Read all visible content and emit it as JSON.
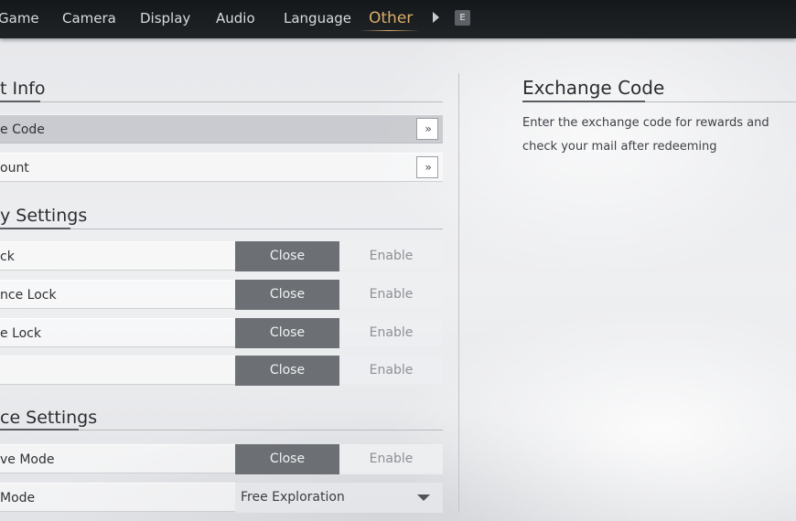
{
  "nav": {
    "tabs": [
      "Game",
      "Camera",
      "Display",
      "Audio",
      "Language",
      "Other"
    ],
    "active_tab": "Other",
    "next_key_hint": "E"
  },
  "account_section": {
    "title": "t Info",
    "rows": [
      {
        "label": "e Code",
        "action": "»"
      },
      {
        "label": "ount",
        "action": "»"
      }
    ]
  },
  "privacy_section": {
    "title": "y Settings",
    "rows": [
      {
        "label": "ck",
        "off_label": "Close",
        "on_label": "Enable",
        "selected": "Close"
      },
      {
        "label": "nce Lock",
        "off_label": "Close",
        "on_label": "Enable",
        "selected": "Close"
      },
      {
        "label": "e Lock",
        "off_label": "Close",
        "on_label": "Enable",
        "selected": "Close"
      },
      {
        "label": "",
        "off_label": "Close",
        "on_label": "Enable",
        "selected": "Close"
      }
    ]
  },
  "device_section": {
    "title": "ce Settings",
    "rows": [
      {
        "label": "ve Mode",
        "off_label": "Close",
        "on_label": "Enable",
        "selected": "Close"
      },
      {
        "label": " Mode",
        "dropdown_value": "Free Exploration"
      }
    ]
  },
  "detail": {
    "title": "Exchange Code",
    "description": "Enter the exchange code for rewards and check your mail after redeeming"
  },
  "colors": {
    "accent": "#d9ad6a",
    "toggle_selected": "#6c7075",
    "topbar": "#1b1e21"
  }
}
